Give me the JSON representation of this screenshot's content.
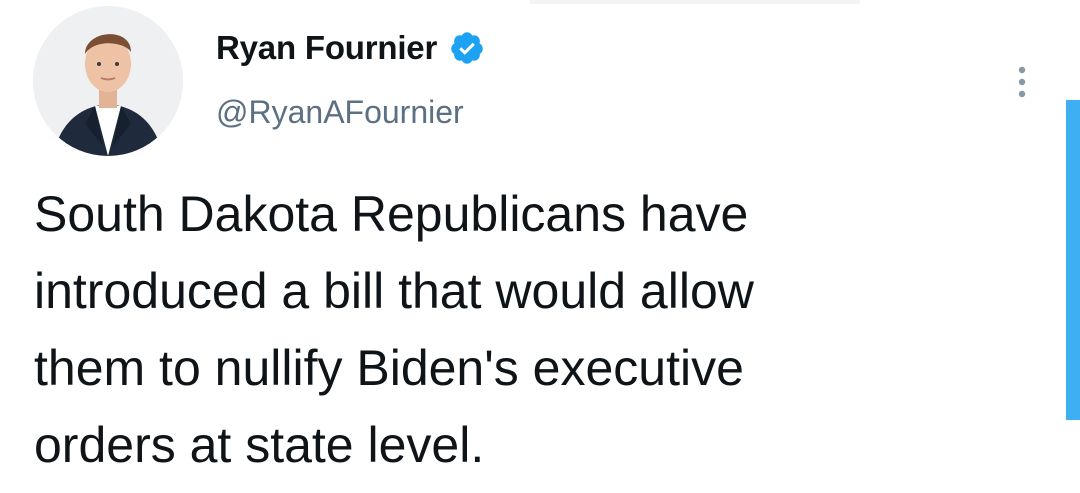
{
  "tweet": {
    "author": {
      "display_name": "Ryan Fournier",
      "handle": "@RyanAFournier",
      "verified": true
    },
    "text": "South Dakota Republicans have\nintroduced a bill that would allow\nthem to nullify Biden's executive\norders at state level."
  },
  "icons": {
    "verified": "verified-badge-icon",
    "more": "more-options-icon"
  },
  "colors": {
    "accent": "#1da1f2",
    "text": "#0f1419",
    "secondary_text": "#5b7083"
  }
}
